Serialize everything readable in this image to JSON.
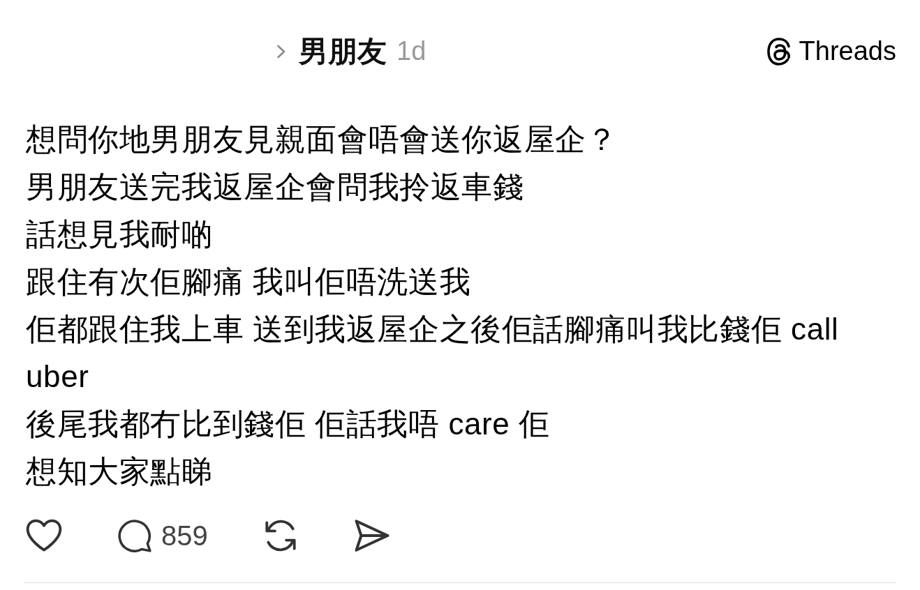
{
  "header": {
    "breadcrumb": "男朋友",
    "time": "1d"
  },
  "brand": {
    "name": "Threads"
  },
  "post": {
    "lines": [
      "想問你地男朋友見親面會唔會送你返屋企？",
      "男朋友送完我返屋企會問我拎返車錢",
      "話想見我耐啲",
      "跟住有次佢腳痛 我叫佢唔洗送我",
      "佢都跟住我上車 送到我返屋企之後佢話腳痛叫我比錢佢 call uber",
      "後尾我都冇比到錢佢 佢話我唔 care 佢",
      "想知大家點睇"
    ]
  },
  "actions": [
    {
      "kind": "like"
    },
    {
      "kind": "reply",
      "count": "859"
    },
    {
      "kind": "repost"
    },
    {
      "kind": "share"
    }
  ]
}
